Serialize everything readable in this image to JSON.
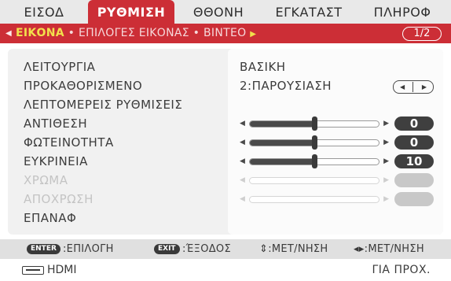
{
  "tabs": [
    "ΕΙΣΟΔ",
    "ΡΥΘΜΙΣΗ",
    "ΘΘΟΝΗ",
    "ΕΓΚΑΤΑΣΤ",
    "ΠΛΗΡΟΦ"
  ],
  "active_tab": "ΡΥΘΜΙΣΗ",
  "subbar": {
    "current": "ΕΙΚΟΝΑ",
    "sep1": "•",
    "item2": "ΕΠΙΛΟΓΕΣ ΕΙΚΟΝΑΣ",
    "sep2": "•",
    "item3": "ΒΙΝΤΕΟ",
    "page": "1/2"
  },
  "rows": [
    {
      "label": "ΛΕΙΤΟΥΡΓΙΑ",
      "value": "ΒΑΣΙΚΗ"
    },
    {
      "label": "ΠΡΟΚΑΘΟΡΙΣΜΕΝΟ",
      "value": "2:ΠΑΡΟΥΣΙΑΣΗ"
    },
    {
      "label": "ΛΕΠΤΟΜΕΡΕΙΣ ΡΥΘΜΙΣΕΙΣ"
    },
    {
      "label": "ΑΝΤΙΘΕΣΗ",
      "value": "0",
      "level": 0.5
    },
    {
      "label": "ΦΩΤΕΙΝΟΤΗΤΑ",
      "value": "0",
      "level": 0.5
    },
    {
      "label": "ΕΥΚΡΙΝΕΙΑ",
      "value": "10",
      "level": 0.5
    },
    {
      "label": "ΧΡΩΜΑ",
      "disabled": true
    },
    {
      "label": "ΑΠΟΧΡΩΣΗ",
      "disabled": true
    },
    {
      "label": "ΕΠΑΝΑΦ"
    }
  ],
  "help": {
    "enter_key": "ENTER",
    "enter_label": ":ΕΠΙΛΟΓΗ",
    "exit_key": "EXIT",
    "exit_label": ":ΈΞΟΔΟΣ",
    "move_label": "⇕:ΜΕΤ/ΝΗΣΗ",
    "adjust_label": "◂▸:ΜΕΤ/ΝΗΣΗ"
  },
  "status": {
    "source": "HDMI",
    "advanced": "ΓΙΑ ΠΡΟΧ."
  },
  "colors": {
    "accent": "#cc2e36",
    "highlight": "#f2e04c"
  },
  "icons": {
    "source": "hdmi-connector-icon",
    "left_arrow": "triangle-left",
    "right_arrow": "triangle-right"
  }
}
